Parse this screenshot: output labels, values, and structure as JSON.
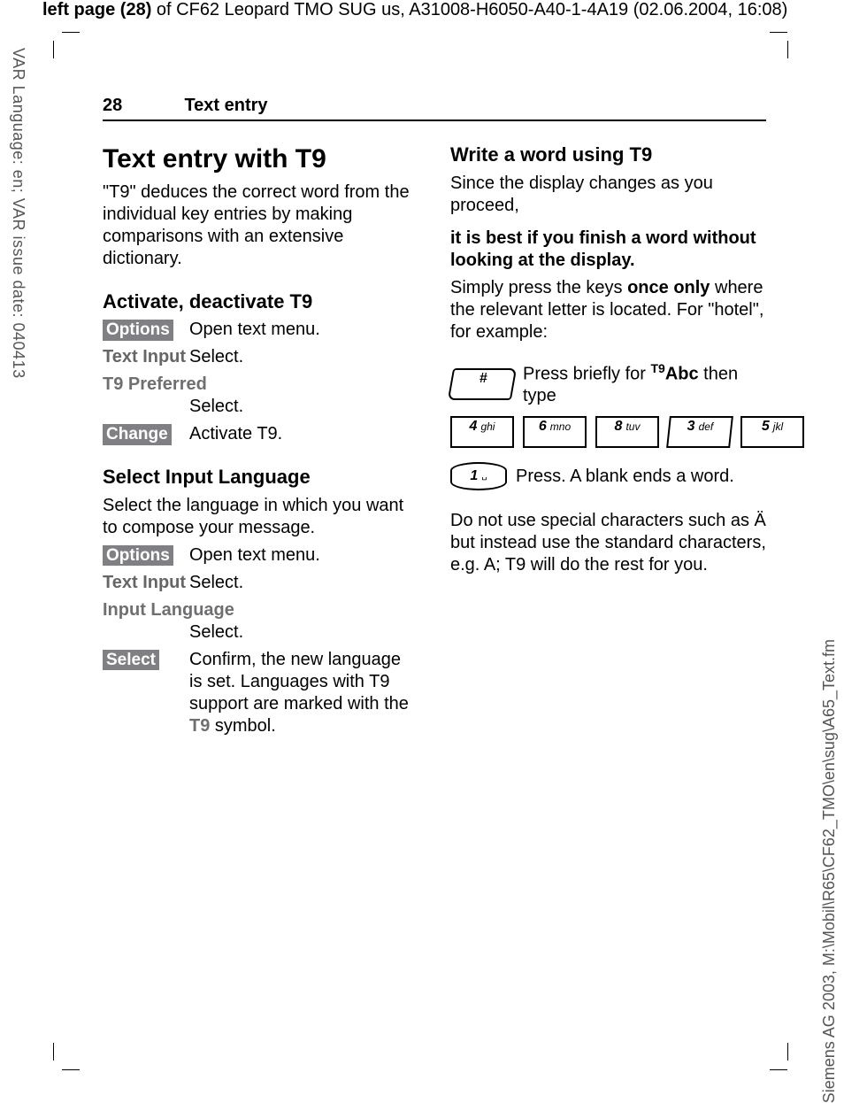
{
  "top_header": {
    "bold": "left page (28)",
    "rest": " of CF62 Leopard TMO SUG us, A31008-H6050-A40-1-4A19 (02.06.2004, 16:08)"
  },
  "side_left": "VAR Language: en; VAR issue date: 040413",
  "side_right": "Siemens AG 2003, M:\\Mobil\\R65\\CF62_TMO\\en\\sug\\A65_Text.fm",
  "running": {
    "page": "28",
    "section": "Text entry"
  },
  "left": {
    "h1": "Text entry with T9",
    "intro": "\"T9\" deduces the correct word from the individual key entries by making comparisons with an extensive dictionary.",
    "h2a": "Activate, deactivate T9",
    "row1": {
      "btn": "Options",
      "val": "Open text menu."
    },
    "row2": {
      "key": "Text Input",
      "val": "Select."
    },
    "row3": {
      "key": "T9 Preferred",
      "val": "Select."
    },
    "row4": {
      "btn": "Change",
      "val": "Activate T9."
    },
    "h2b": "Select Input Language",
    "p2": "Select the language in which you want to compose your message.",
    "row5": {
      "btn": "Options",
      "val": "Open text menu."
    },
    "row6": {
      "key": "Text Input",
      "val": "Select."
    },
    "row7": {
      "key": "Input Language",
      "val": "Select."
    },
    "row8": {
      "btn": "Select",
      "val_a": "Confirm, the new language is set. Languages with T9 support are marked with the ",
      "t9": "T9",
      "val_b": " symbol."
    }
  },
  "right": {
    "h2": "Write a word using T9",
    "p1": "Since the display changes as you proceed,",
    "p2": "it is best if you finish a word without looking at the display.",
    "p3a": "Simply press the keys ",
    "p3b": "once only",
    "p3c": " where the relevant letter is located. For \"hotel\", for example:",
    "hash_desc_a": "Press briefly for ",
    "hash_desc_sup": "T9",
    "hash_desc_b": "Abc",
    "hash_desc_c": " then type",
    "keys": [
      {
        "n": "4",
        "s": "ghi"
      },
      {
        "n": "6",
        "s": "mno"
      },
      {
        "n": "8",
        "s": "tuv"
      },
      {
        "n": "3",
        "s": "def"
      },
      {
        "n": "5",
        "s": "jkl"
      }
    ],
    "one_desc": "Press. A blank ends a word.",
    "p4": "Do not use special characters such as Ä but instead use the standard characters, e.g. A; T9 will do the rest for you.",
    "hash_label": "#",
    "one_label_n": "1",
    "one_label_s": "␣"
  }
}
